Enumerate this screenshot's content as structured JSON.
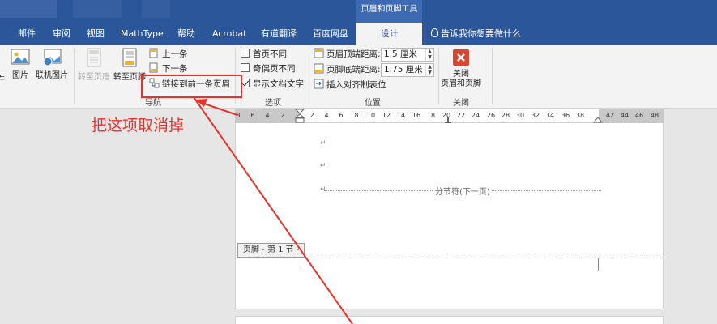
{
  "titlebar": {
    "contextual_group": "页眉和页脚工具"
  },
  "tabs": [
    {
      "label": "邮件"
    },
    {
      "label": "审阅"
    },
    {
      "label": "视图"
    },
    {
      "label": "MathType"
    },
    {
      "label": "帮助"
    },
    {
      "label": "Acrobat"
    },
    {
      "label": "有道翻译"
    },
    {
      "label": "百度网盘"
    },
    {
      "label": "设计"
    }
  ],
  "tell_me": "告诉我你想要做什么",
  "ribbon": {
    "insert": {
      "partial_label": "件",
      "picture": "图片",
      "online_picture": "联机图片"
    },
    "navigation": {
      "goto_header": "转至页眉",
      "goto_footer": "转至页脚",
      "previous": "上一条",
      "next": "下一条",
      "link_to_previous": "链接到前一条页眉",
      "group_label": "导航"
    },
    "options": {
      "different_first_page": "首页不同",
      "different_odd_even": "奇偶页不同",
      "show_document_text": "显示文档文字",
      "group_label": "选项"
    },
    "position": {
      "header_from_top_label": "页眉顶端距离:",
      "header_from_top_value": "1.5 厘米",
      "footer_from_bottom_label": "页脚底端距离:",
      "footer_from_bottom_value": "1.75 厘米",
      "insert_alignment_tab": "插入对齐制表位",
      "group_label": "位置"
    },
    "close": {
      "line1": "关闭",
      "line2": "页眉和页脚",
      "group_label": "关闭"
    }
  },
  "ruler": {
    "ticks": [
      "8",
      "6",
      "4",
      "2",
      "2",
      "4",
      "6",
      "8",
      "10",
      "12",
      "14",
      "16",
      "18",
      "20",
      "22",
      "24",
      "26",
      "28",
      "30",
      "32",
      "34",
      "36",
      "38",
      "42",
      "44",
      "46",
      "48"
    ]
  },
  "document": {
    "paragraph_mark": "↵",
    "section_break": "分节符(下一页)",
    "footer_tag": "页脚 - 第 1 节 -"
  },
  "annotation": {
    "text": "把这项取消掉",
    "color": "#e8312a"
  },
  "colors": {
    "ribbon_blue": "#2b579a",
    "accent_red": "#e8312a"
  }
}
